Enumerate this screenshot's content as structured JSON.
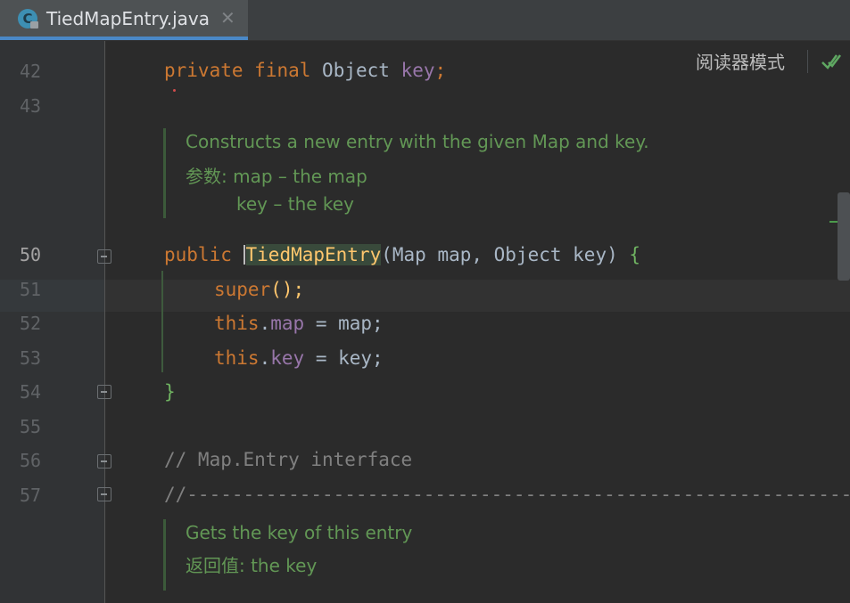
{
  "tab": {
    "title": "TiedMapEntry.java",
    "icon_letter": "C",
    "close": "✕"
  },
  "reader_mode": {
    "label": "阅读器模式"
  },
  "line_numbers": {
    "n42": "42",
    "n43": "43",
    "n50": "50",
    "n51": "51",
    "n52": "52",
    "n53": "53",
    "n54": "54",
    "n55": "55",
    "n56": "56",
    "n57": "57"
  },
  "code": {
    "l42": {
      "kw1": "private",
      "kw2": "final",
      "type": "Object",
      "field": "key",
      "semi": ";"
    },
    "l50": {
      "kw": "public",
      "ctor": "TiedMapEntry",
      "params": "(Map map, Object key)",
      "brace": "{"
    },
    "l51": {
      "kw": "super",
      "rest": "();"
    },
    "l52": {
      "kw": "this",
      "dot": ".",
      "field": "map",
      "rest": " = map;"
    },
    "l53": {
      "kw": "this",
      "dot": ".",
      "field": "key",
      "rest": " = key;"
    },
    "l54": {
      "brace": "}"
    },
    "l56": {
      "comment": "// Map.Entry interface"
    },
    "l57": {
      "comment": "//--------------------------------------------------------------"
    }
  },
  "doc1": {
    "line1": "Constructs a new entry with the given Map and key.",
    "line2": "参数: map – the map",
    "line3": "key – the key"
  },
  "doc2": {
    "line1": "Gets the key of this entry",
    "line2": "返回值: the key"
  },
  "colors": {
    "keyword": "#cc7832",
    "field": "#9876aa",
    "method": "#ffc66d",
    "doc": "#629755",
    "comment": "#808080",
    "accent": "#4a88c7"
  }
}
